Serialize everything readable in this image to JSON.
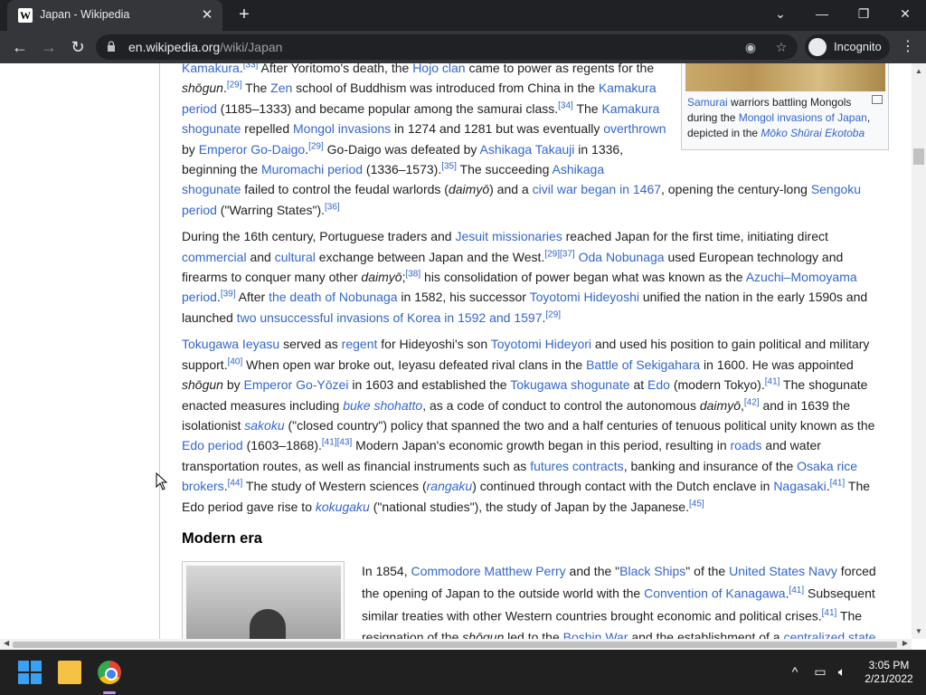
{
  "browser": {
    "tab_title": "Japan - Wikipedia",
    "favicon_letter": "W",
    "url_host": "en.wikipedia.org",
    "url_path": "/wiki/Japan",
    "incognito_label": "Incognito"
  },
  "thumb": {
    "caption_link1": "Samurai",
    "caption_text1": " warriors battling Mongols during the ",
    "caption_link2": "Mongol invasions of Japan",
    "caption_text2": ", depicted in the ",
    "caption_link3": "Mōko Shūrai Ekotoba"
  },
  "section_heading": "Modern era",
  "taskbar": {
    "time": "3:05 PM",
    "date": "2/21/2022"
  }
}
